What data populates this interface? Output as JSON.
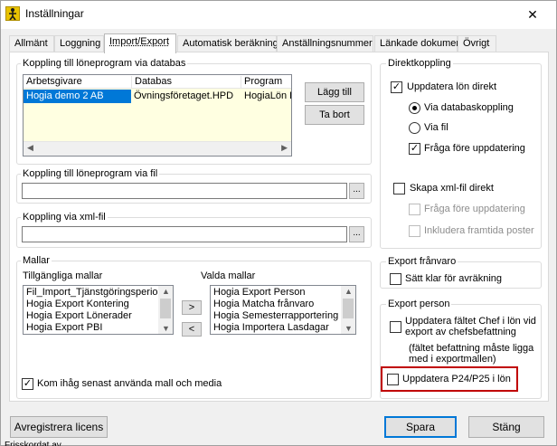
{
  "window": {
    "title": "Inställningar",
    "close_symbol": "✕"
  },
  "tabs": [
    {
      "label": "Allmänt"
    },
    {
      "label": "Loggning"
    },
    {
      "label": "Import/Export"
    },
    {
      "label": "Automatisk beräkning"
    },
    {
      "label": "Anställningsnummer"
    },
    {
      "label": "Länkade dokument"
    },
    {
      "label": "Övrigt"
    }
  ],
  "db_link": {
    "title": "Koppling till löneprogram via databas",
    "columns": [
      "Arbetsgivare",
      "Databas",
      "Program"
    ],
    "rows": [
      [
        "Hogia demo 2 AB",
        "Övningsföretaget.HPD",
        "HogiaLön P"
      ]
    ],
    "add_label": "Lägg till",
    "remove_label": "Ta bort"
  },
  "file_link": {
    "title": "Koppling till löneprogram via fil",
    "value": "",
    "browse_label": "..."
  },
  "xml_link": {
    "title": "Koppling via xml-fil",
    "value": "",
    "browse_label": "..."
  },
  "templates": {
    "title": "Mallar",
    "available_label": "Tillgängliga mallar",
    "selected_label": "Valda mallar",
    "available": [
      "Fil_Import_Tjänstgöringsperiode",
      "Hogia Export Kontering",
      "Hogia Export Lönerader",
      "Hogia Export PBI"
    ],
    "selected": [
      "Hogia Export Person",
      "Hogia Matcha frånvaro",
      "Hogia Semesterrapportering",
      "Hogia Importera Lasdagar"
    ],
    "move_right": ">",
    "move_left": "<",
    "remember_label": "Kom ihåg senast använda mall och media",
    "remember_checked": true
  },
  "direct": {
    "title": "Direktkoppling",
    "update_label": "Uppdatera lön direkt",
    "update_checked": true,
    "via_db_label": "Via databaskoppling",
    "via_db_selected": true,
    "via_file_label": "Via fil",
    "via_file_selected": false,
    "ask_label": "Fråga före uppdatering",
    "ask_checked": true,
    "xml_label": "Skapa xml-fil direkt",
    "xml_checked": false,
    "xml_ask_label": "Fråga före uppdatering",
    "xml_future_label": "Inkludera framtida poster"
  },
  "absence": {
    "title": "Export frånvaro",
    "ready_label": "Sätt klar för avräkning",
    "ready_checked": false
  },
  "person": {
    "title": "Export person",
    "chef_label_1": "Uppdatera fältet Chef i lön vid",
    "chef_label_2": "export av chefsbefattning",
    "chef_note_1": "(fältet befattning måste ligga",
    "chef_note_2": "med i exportmallen)",
    "chef_checked": false,
    "p24_label": "Uppdatera P24/P25 i lön",
    "p24_checked": false
  },
  "footer": {
    "unregister_label": "Avregistrera licens",
    "save_label": "Spara",
    "close_label": "Stäng",
    "below_text": "Frisskordat av"
  },
  "colors": {
    "selection": "#0078d7",
    "grid_background": "#ffffe1",
    "highlight_border": "#c00000"
  }
}
